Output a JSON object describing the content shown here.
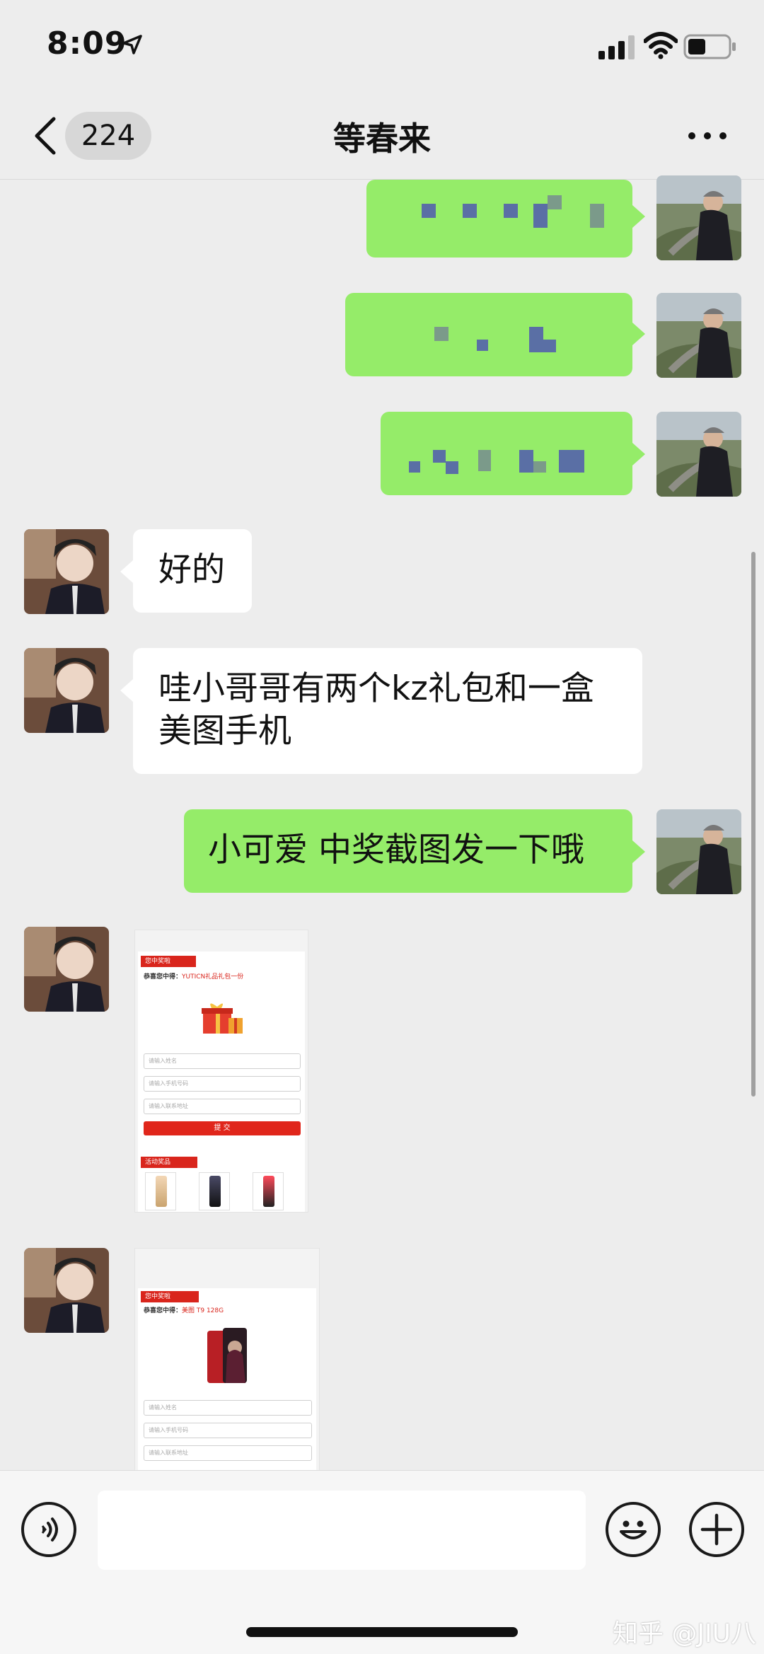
{
  "status_bar": {
    "time": "8:09"
  },
  "nav": {
    "unread_count": "224",
    "title": "等春来"
  },
  "messages": [
    {
      "from": "me",
      "type": "text",
      "text": ""
    },
    {
      "from": "me",
      "type": "text",
      "text": ""
    },
    {
      "from": "me",
      "type": "text",
      "text": ""
    },
    {
      "from": "other",
      "type": "text",
      "text": "好的"
    },
    {
      "from": "other",
      "type": "text",
      "line1": "哇小哥哥有两个kz礼包和一盒",
      "line2": "美图手机"
    },
    {
      "from": "me",
      "type": "text",
      "text": "小可爱 中奖截图发一下哦"
    },
    {
      "from": "other",
      "type": "image",
      "tag": "您中奖啦",
      "congrats_prefix": "恭喜您中得：",
      "prize": "YUTICN礼品礼包一份",
      "fields": [
        "请输入姓名",
        "请输入手机号码",
        "请输入联系地址"
      ],
      "submit": "提 交",
      "section_tag": "活动奖品"
    },
    {
      "from": "other",
      "type": "image",
      "tag": "您中奖啦",
      "congrats_prefix": "恭喜您中得：",
      "prize": "美图 T9 128G",
      "fields": [
        "请输入姓名",
        "请输入手机号码",
        "请输入联系地址"
      ]
    }
  ],
  "input_bar": {
    "voice_icon": "voice-icon",
    "emoji_icon": "emoji-icon",
    "plus_icon": "plus-icon"
  },
  "watermark": "知乎 @JIU八",
  "colors": {
    "my_bubble": "#95ec69",
    "other_bubble": "#ffffff",
    "background": "#ededed",
    "accent_red": "#d9251c"
  }
}
